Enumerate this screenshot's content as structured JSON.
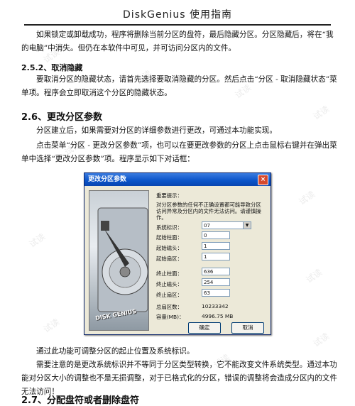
{
  "header": {
    "title": "DiskGenius 使用指南"
  },
  "body": {
    "para1": "如果锁定或卸载成功，程序将删除当前分区的盘符，最后隐藏分区。分区隐藏后，将在“我的电脑”中消失。但仍在本软件中可见，并可访问分区内的文件。",
    "h_252": "2.5.2、取消隐藏",
    "para2": "要取消分区的隐藏状态，请首先选择要取消隐藏的分区。然后点击“分区 - 取消隐藏状态”菜单项。程序会立即取消这个分区的隐藏状态。",
    "h_26": "2.6、更改分区参数",
    "para3": "分区建立后，如果需要对分区的详细参数进行更改，可通过本功能实现。",
    "para4": "点击菜单“分区 - 更改分区参数”项，也可以在要更改参数的分区上点击鼠标右键并在弹出菜单中选择“更改分区参数”项。程序显示如下对话框：",
    "para5": "通过此功能可调整分区的起止位置及系统标识。",
    "para6": "需要注意的是更改系统标识并不等同于分区类型转换，它不能改变文件系统类型。通过本功能对分区大小的调整也不是无损调整，对于已格式化的分区，错误的调整将会造成分区内的文件无法访问！",
    "h_27": "2.7、分配盘符或者删除盘符"
  },
  "dialog": {
    "title": "更改分区参数",
    "close": "×",
    "warning_title": "重要提示：",
    "warning_text": "对分区参数的任何不正确设置都可能导致分区访问异常及分区内的文件无法访问。请谨慎操作。",
    "system_id_label": "系统标识：",
    "system_id_value": "07",
    "start_cyl_label": "起始柱面：",
    "start_cyl_value": "0",
    "start_head_label": "起始磁头：",
    "start_head_value": "1",
    "start_sector_label": "起始扇区：",
    "start_sector_value": "1",
    "end_cyl_label": "终止柱面：",
    "end_cyl_value": "636",
    "end_head_label": "终止磁头：",
    "end_head_value": "254",
    "end_sector_label": "终止扇区：",
    "end_sector_value": "63",
    "total_sectors_label": "总扇区数：",
    "total_sectors_value": "10233342",
    "capacity_label": "容量(MB)：",
    "capacity_value": "4996.75 MB",
    "ok": "确定",
    "cancel": "取消",
    "image_label": "DISK GENIUS"
  },
  "watermark": "试读"
}
